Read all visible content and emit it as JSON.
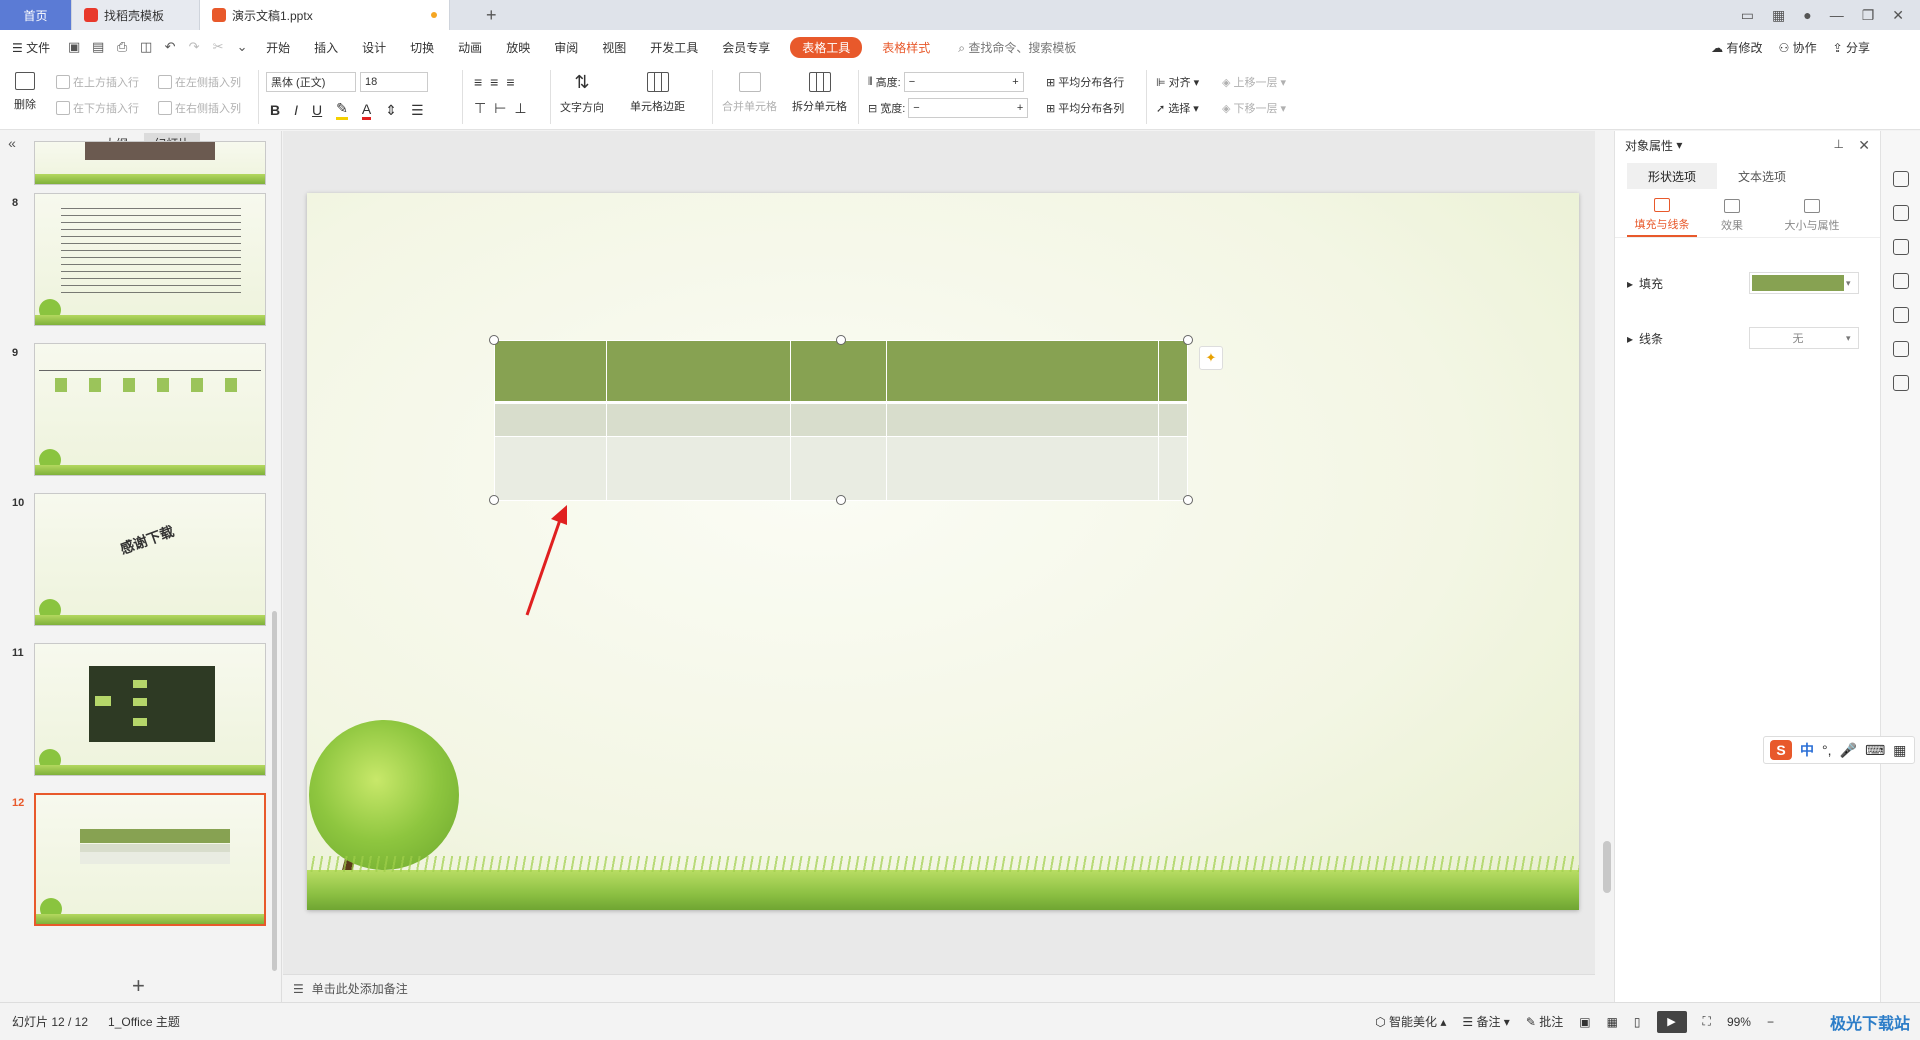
{
  "tabs": {
    "home": "首页",
    "template": "找稻壳模板",
    "doc": "演示文稿1.pptx"
  },
  "menu": {
    "file": "文件",
    "items": [
      "开始",
      "插入",
      "设计",
      "切换",
      "动画",
      "放映",
      "审阅",
      "视图",
      "开发工具",
      "会员专享"
    ],
    "table_tools": "表格工具",
    "table_style": "表格样式",
    "search": "查找命令、搜索模板",
    "right": [
      "有修改",
      "协作",
      "分享"
    ]
  },
  "ribbon": {
    "delete": "删除",
    "insert_above": "在上方插入行",
    "insert_below": "在下方插入行",
    "insert_left": "在左侧插入列",
    "insert_right": "在右侧插入列",
    "font": "黑体 (正文)",
    "font_size": "18",
    "text_direction": "文字方向",
    "cell_margin": "单元格边距",
    "merge_cells": "合并单元格",
    "split_cells": "拆分单元格",
    "height_label": "高度:",
    "width_label": "宽度:",
    "dist_rows": "平均分布各行",
    "dist_cols": "平均分布各列",
    "align": "对齐",
    "select": "选择",
    "bring_forward": "上移一层",
    "send_backward": "下移一层"
  },
  "left_panel": {
    "outline": "大纲",
    "slides": "幻灯片",
    "thumbs": [
      {
        "num": "8"
      },
      {
        "num": "9"
      },
      {
        "num": "10",
        "text": "感谢下载"
      },
      {
        "num": "11"
      },
      {
        "num": "12"
      }
    ]
  },
  "notes_placeholder": "单击此处添加备注",
  "props": {
    "title": "对象属性",
    "tab_shape": "形状选项",
    "tab_text": "文本选项",
    "sub_fill_line": "填充与线条",
    "sub_effect": "效果",
    "sub_size": "大小与属性",
    "fill_label": "填充",
    "line_label": "线条",
    "line_value": "无",
    "fill_color": "#87a252"
  },
  "ime": {
    "mode": "中"
  },
  "status": {
    "slide_info": "幻灯片 12 / 12",
    "theme": "1_Office 主题",
    "beautify": "智能美化",
    "notes": "备注",
    "comments": "批注",
    "zoom": "99%",
    "site": "极光下载站"
  },
  "colors": {
    "accent": "#e8592b",
    "table_header": "#87a252",
    "table_row1": "#d8ddcc",
    "table_row2": "#e9ece2",
    "home_tab": "#5b7bd5"
  }
}
